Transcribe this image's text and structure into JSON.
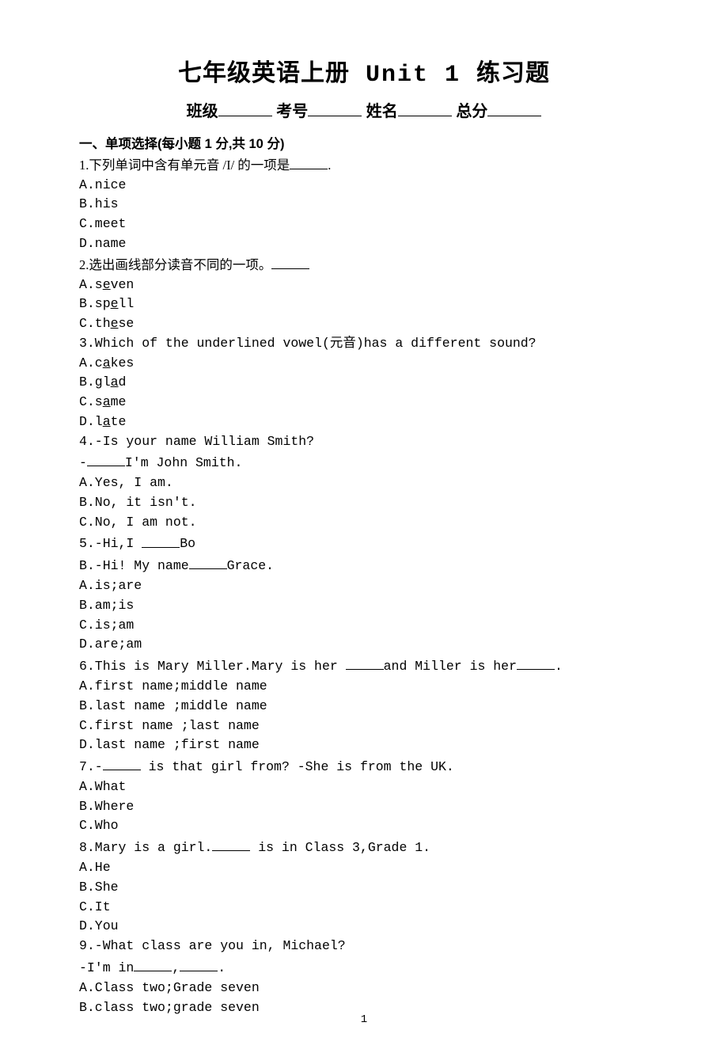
{
  "title_cn_pre": "七年级英语上册",
  "title_latin": " Unit 1 ",
  "title_cn_post": "练习题",
  "header_labels": {
    "class": "班级",
    "num": "考号",
    "name": "姓名",
    "score": "总分"
  },
  "section1": {
    "heading": "一、单项选择(每小题 1 分,共 10 分)"
  },
  "q1": {
    "stem_pre": "1.下列单词中含有单元音 /I/ 的一项是",
    "stem_post": ".",
    "A": "A.nice",
    "B": "B.his",
    "C": "C.meet",
    "D": "D.name"
  },
  "q2": {
    "stem_pre": "2.选出画线部分读音不同的一项。",
    "A_pre": "A.s",
    "A_u": "e",
    "A_post": "ven",
    "B_pre": "B.sp",
    "B_u": "e",
    "B_post": "ll",
    "C_pre": "C.th",
    "C_u": "e",
    "C_post": "se"
  },
  "q3": {
    "stem": "3.Which of the underlined vowel(元音)has a different sound?",
    "A_pre": "A.c",
    "A_u": "a",
    "A_post": "kes",
    "B_pre": "B.gl",
    "B_u": "a",
    "B_post": "d",
    "C_pre": "C.s",
    "C_u": "a",
    "C_post": "me",
    "D_pre": "D.l",
    "D_u": "a",
    "D_post": "te"
  },
  "q4": {
    "stem": "4.-Is your name William Smith?",
    "stem2_pre": "-",
    "stem2_post": "I'm John Smith.",
    "A": "A.Yes, I am.",
    "B": "B.No, it isn't.",
    "C": "C.No, I am not."
  },
  "q5": {
    "stem_pre": "5.-Hi,I ",
    "stem_post": "Bo",
    "stem2_pre": "B.-Hi! My name",
    "stem2_post": "Grace.",
    "A": "A.is;are",
    "B": "B.am;is",
    "C": "C.is;am",
    "D": "D.are;am"
  },
  "q6": {
    "stem_pre": "6.This is Mary Miller.Mary is her ",
    "stem_mid": "and Miller is her",
    "stem_post": ".",
    "A": "A.first name;middle name",
    "B": "B.last name ;middle name",
    "C": "C.first name ;last name",
    "D": "D.last name ;first name"
  },
  "q7": {
    "stem_pre": "7.-",
    "stem_post": " is that girl from? -She is from the UK.",
    "A": "A.What",
    "B": "B.Where",
    "C": "C.Who"
  },
  "q8": {
    "stem_pre": "8.Mary is a girl.",
    "stem_post": " is in Class 3,Grade 1.",
    "A": "A.He",
    "B": "B.She",
    "C": "C.It",
    "D": "D.You"
  },
  "q9": {
    "stem": "9.-What class are you in, Michael?",
    "stem2_pre": "-I'm in",
    "stem2_mid": ",",
    "stem2_post": ".",
    "A": "A.Class two;Grade seven",
    "B": "B.class two;grade seven"
  },
  "page_number": "1"
}
